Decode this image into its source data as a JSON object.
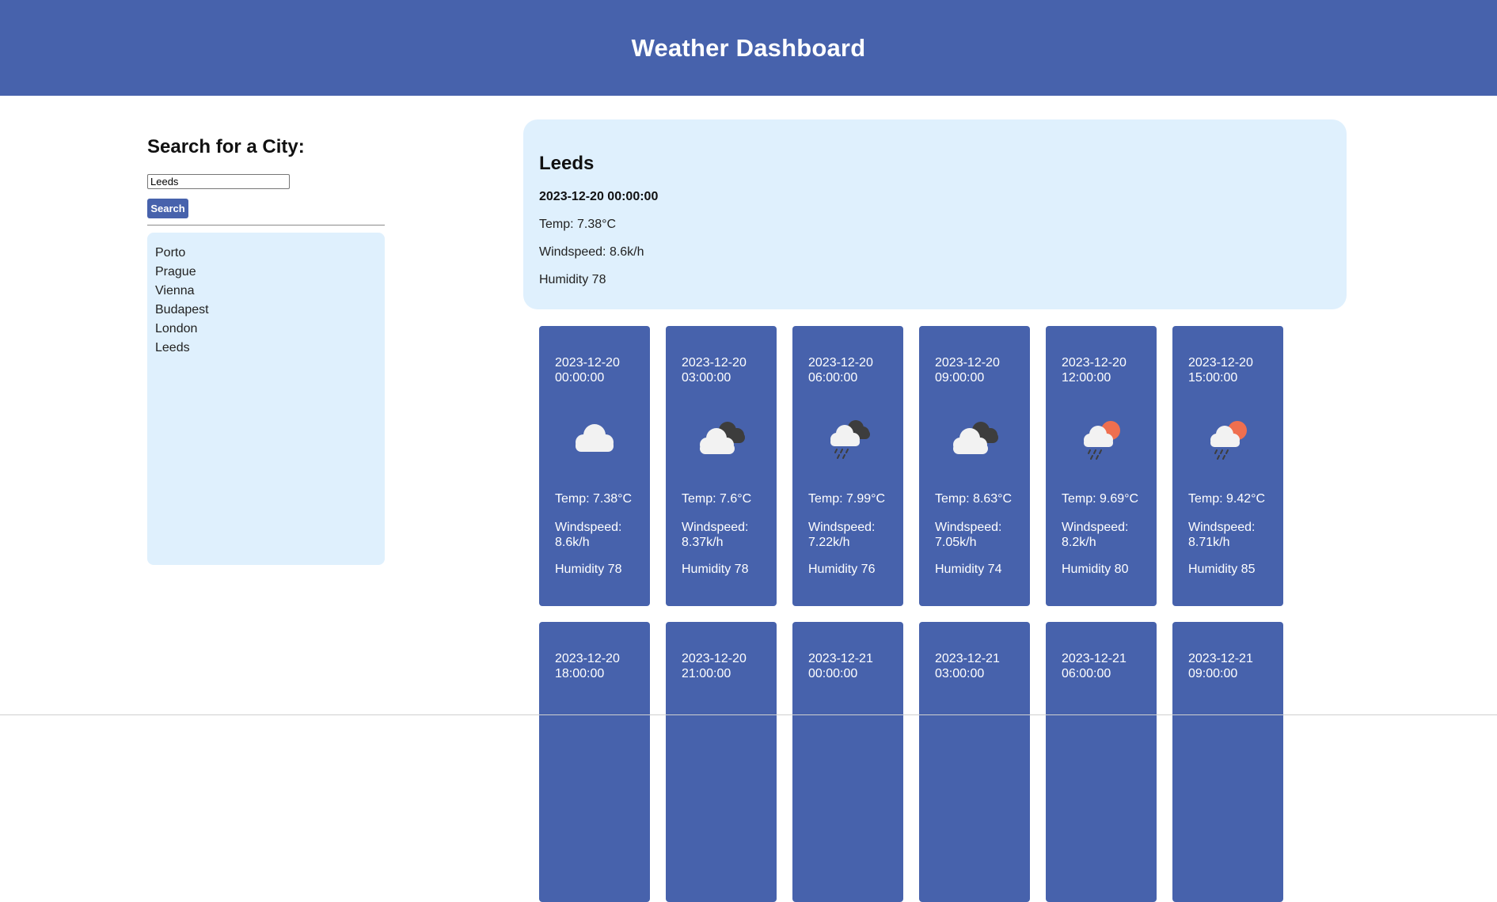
{
  "header": {
    "title": "Weather Dashboard"
  },
  "search": {
    "title": "Search for a City:",
    "input_value": "Leeds",
    "button_label": "Search"
  },
  "history": [
    "Porto",
    "Prague",
    "Vienna",
    "Budapest",
    "London",
    "Leeds"
  ],
  "current": {
    "city": "Leeds",
    "date": "2023-12-20 00:00:00",
    "temp": "Temp: 7.38°C",
    "wind": "Windspeed: 8.6k/h",
    "humidity": "Humidity 78"
  },
  "forecast": [
    {
      "date": "2023-12-20 00:00:00",
      "icon": "cloud-icon",
      "temp": "Temp: 7.38°C",
      "wind": "Windspeed: 8.6k/h",
      "humidity": "Humidity 78"
    },
    {
      "date": "2023-12-20 03:00:00",
      "icon": "broken-clouds-icon",
      "temp": "Temp: 7.6°C",
      "wind": "Windspeed: 8.37k/h",
      "humidity": "Humidity 78"
    },
    {
      "date": "2023-12-20 06:00:00",
      "icon": "rain-night-icon",
      "temp": "Temp: 7.99°C",
      "wind": "Windspeed: 7.22k/h",
      "humidity": "Humidity 76"
    },
    {
      "date": "2023-12-20 09:00:00",
      "icon": "broken-clouds-icon",
      "temp": "Temp: 8.63°C",
      "wind": "Windspeed: 7.05k/h",
      "humidity": "Humidity 74"
    },
    {
      "date": "2023-12-20 12:00:00",
      "icon": "rain-sun-icon",
      "temp": "Temp: 9.69°C",
      "wind": "Windspeed: 8.2k/h",
      "humidity": "Humidity 80"
    },
    {
      "date": "2023-12-20 15:00:00",
      "icon": "rain-sun-icon",
      "temp": "Temp: 9.42°C",
      "wind": "Windspeed: 8.71k/h",
      "humidity": "Humidity 85"
    },
    {
      "date": "2023-12-20 18:00:00"
    },
    {
      "date": "2023-12-20 21:00:00"
    },
    {
      "date": "2023-12-21 00:00:00"
    },
    {
      "date": "2023-12-21 03:00:00"
    },
    {
      "date": "2023-12-21 06:00:00"
    },
    {
      "date": "2023-12-21 09:00:00"
    }
  ],
  "colors": {
    "primary": "#4762ac",
    "panel": "#dff0fd",
    "sun": "#ef6f4f",
    "dark_cloud": "#3d3d3d",
    "light_cloud": "#f2f2f2"
  }
}
